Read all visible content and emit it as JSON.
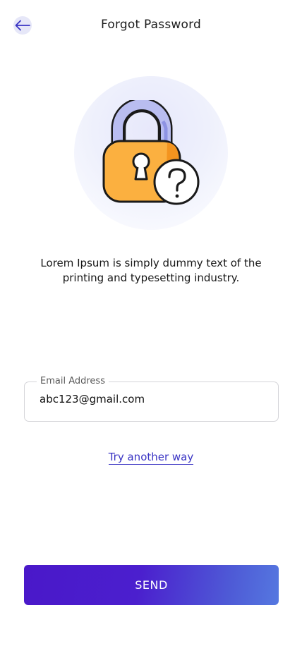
{
  "header": {
    "back_icon": "arrow-left-icon",
    "title": "Forgot Password"
  },
  "illustration": {
    "icon": "lock-question-icon"
  },
  "description": "Lorem Ipsum is simply dummy text of the printing and typesetting industry.",
  "email_field": {
    "label": "Email Address",
    "value": "abc123@gmail.com"
  },
  "alt_link": "Try another way",
  "send_button": "SEND",
  "colors": {
    "accent": "#3a34c4",
    "button_gradient_start": "#4a18c9",
    "button_gradient_end": "#5578e0",
    "lock_body": "#fbb040",
    "lock_shackle": "#b9bdf0"
  }
}
